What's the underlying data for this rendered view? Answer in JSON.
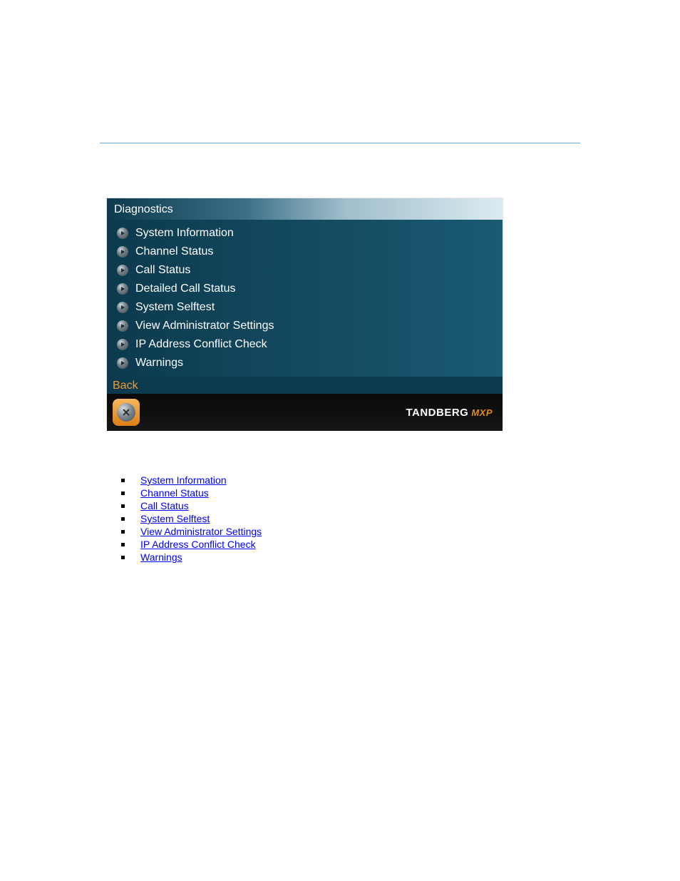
{
  "panel": {
    "title": "Diagnostics",
    "items": [
      "System Information",
      "Channel Status",
      "Call Status",
      "Detailed Call Status",
      "System Selftest",
      "View Administrator Settings",
      "IP Address Conflict Check",
      "Warnings"
    ],
    "back_label": "Back",
    "brand_main": "TANDBERG",
    "brand_sub": "MXP"
  },
  "links": [
    "System Information",
    "Channel Status",
    "Call Status",
    "System Selftest",
    "View Administrator Settings",
    "IP Address Conflict Check",
    "Warnings"
  ]
}
